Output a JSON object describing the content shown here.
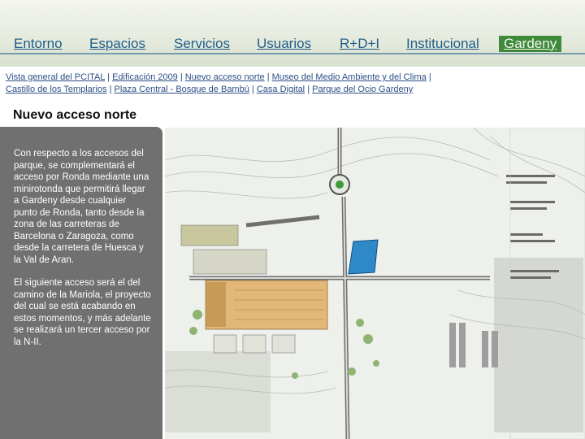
{
  "nav": {
    "items": [
      "Entorno",
      "Espacios",
      "Servicios",
      "Usuarios",
      "R+D+I",
      "Institucional",
      "Gardeny"
    ]
  },
  "sublinks": {
    "row1": [
      "Vista general del PCITAL",
      "Edificación 2009",
      "Nuevo acceso norte",
      "Museo del Medio Ambiente y del Clima"
    ],
    "row2": [
      "Castillo de los Templarios",
      "Plaza Central - Bosque de Bambú",
      "Casa Digital",
      "Parque del Ocio Gardeny"
    ],
    "separator": "|"
  },
  "page": {
    "title": "Nuevo acceso norte",
    "paragraph1": "Con respecto a los accesos del parque, se complementará el acceso por Ronda mediante una minirotonda que permitirá llegar a Gardeny desde cualquier punto de Ronda, tanto desde la zona de las carreteras de Barcelona o Zaragoza, como desde la carretera de Huesca y la Val de Aran.",
    "paragraph2": "El siguiente acceso será el del camino de la Mariola, el proyecto del cual se está acabando en estos momentos, y más adelante se realizará un tercer acceso por la N-II."
  },
  "colors": {
    "nav_link": "#1f5e8a",
    "active_tab": "#3f8a3a",
    "sidebar": "#707070"
  }
}
